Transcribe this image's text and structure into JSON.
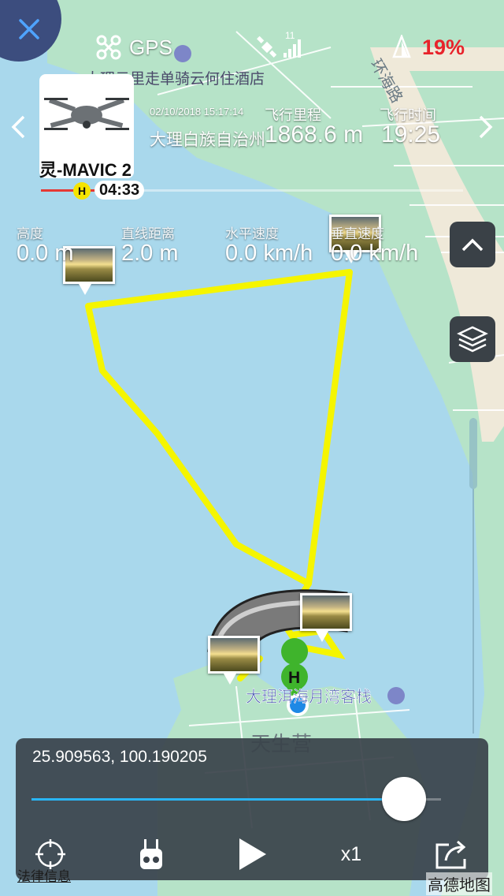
{
  "status_bar": {
    "close_icon": "close-icon",
    "drone_icon": "drone-icon",
    "gps_label": "GPS",
    "satellite_icon": "satellite-icon",
    "satellite_count": "11",
    "battery_icon": "battery-icon",
    "battery_percent": "19%",
    "battery_color": "#e8232b"
  },
  "map_labels": {
    "hotel_top": "大理云里走单骑云何住酒店",
    "road": "环海路",
    "hotel_bottom": "大理洱海月湾客栈",
    "village": "天生营",
    "legal": "法律信息",
    "provider": "高德地图"
  },
  "flight_card": {
    "prev_icon": "chevron-left-icon",
    "next_icon": "chevron-right-icon",
    "drone_model": "灵-MAVIC 2",
    "datetime": "02/10/2018 15:17:14",
    "location": "大理白族自治州",
    "distance_label": "飞行里程",
    "distance_value": "1868.6 m",
    "duration_label": "飞行时间",
    "duration_value": "19:25",
    "home_badge": "H",
    "timeline_time": "04:33"
  },
  "telemetry": [
    {
      "label": "高度",
      "value": "0.0 m"
    },
    {
      "label": "直线距离",
      "value": "2.0 m"
    },
    {
      "label": "水平速度",
      "value": "0.0 km/h"
    },
    {
      "label": "垂直速度",
      "value": "0.0 km/h"
    }
  ],
  "side_controls": {
    "collapse_icon": "chevron-up-icon",
    "layers_icon": "layers-icon"
  },
  "map_markers": {
    "home_badge": "H",
    "flight_path_color": "#f5f500",
    "drone_location_color": "#1e88e5"
  },
  "playback": {
    "coordinates": "25.909563, 100.190205",
    "progress": 0.91,
    "accent_color": "#29b6f6",
    "locate_icon": "crosshair-icon",
    "remote_icon": "remote-controller-icon",
    "play_icon": "play-icon",
    "speed": "x1",
    "share_icon": "share-icon"
  }
}
